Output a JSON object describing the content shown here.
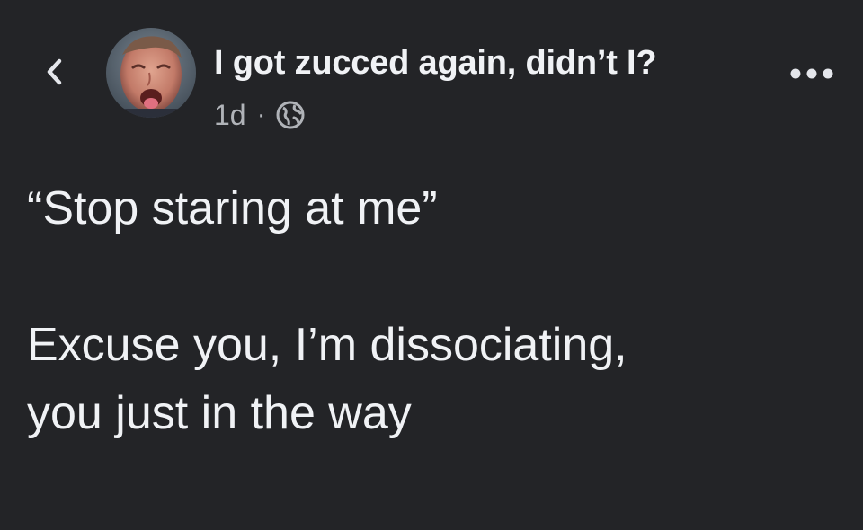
{
  "header": {
    "author_name": "I got zucced again, didn’t I?",
    "timestamp": "1d",
    "separator": "·",
    "audience_icon": "globe-icon",
    "back_icon": "chevron-left-icon",
    "more_icon": "more-horizontal-icon"
  },
  "post": {
    "lines": [
      "“Stop staring at me”",
      "",
      "Excuse you, I’m dissociating,",
      "you just in the way"
    ]
  },
  "colors": {
    "background": "#232427",
    "primary_text": "#f0f2f5",
    "secondary_text": "#b0b3b8"
  }
}
